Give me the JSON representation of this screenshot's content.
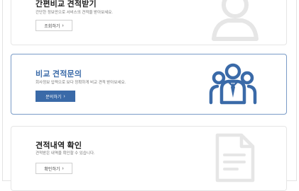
{
  "cards": [
    {
      "title": "간편비교 견적받기",
      "description": "간단한 정보만으로 서비스의 견적을 받아보세요.",
      "button_label": "조회하기"
    },
    {
      "title": "비교 견적문의",
      "description": "회사정보 입력으로 보다 정확하게 비교 견적 받아보세요.",
      "button_label": "문의하기"
    },
    {
      "title": "견적내역 확인",
      "description": "견적받은 내역을 확인할 수 있습니다.",
      "button_label": "확인하기"
    }
  ],
  "chevron": "›",
  "colors": {
    "accent": "#3a6aa8",
    "icon_light": "#e6e6e6"
  }
}
